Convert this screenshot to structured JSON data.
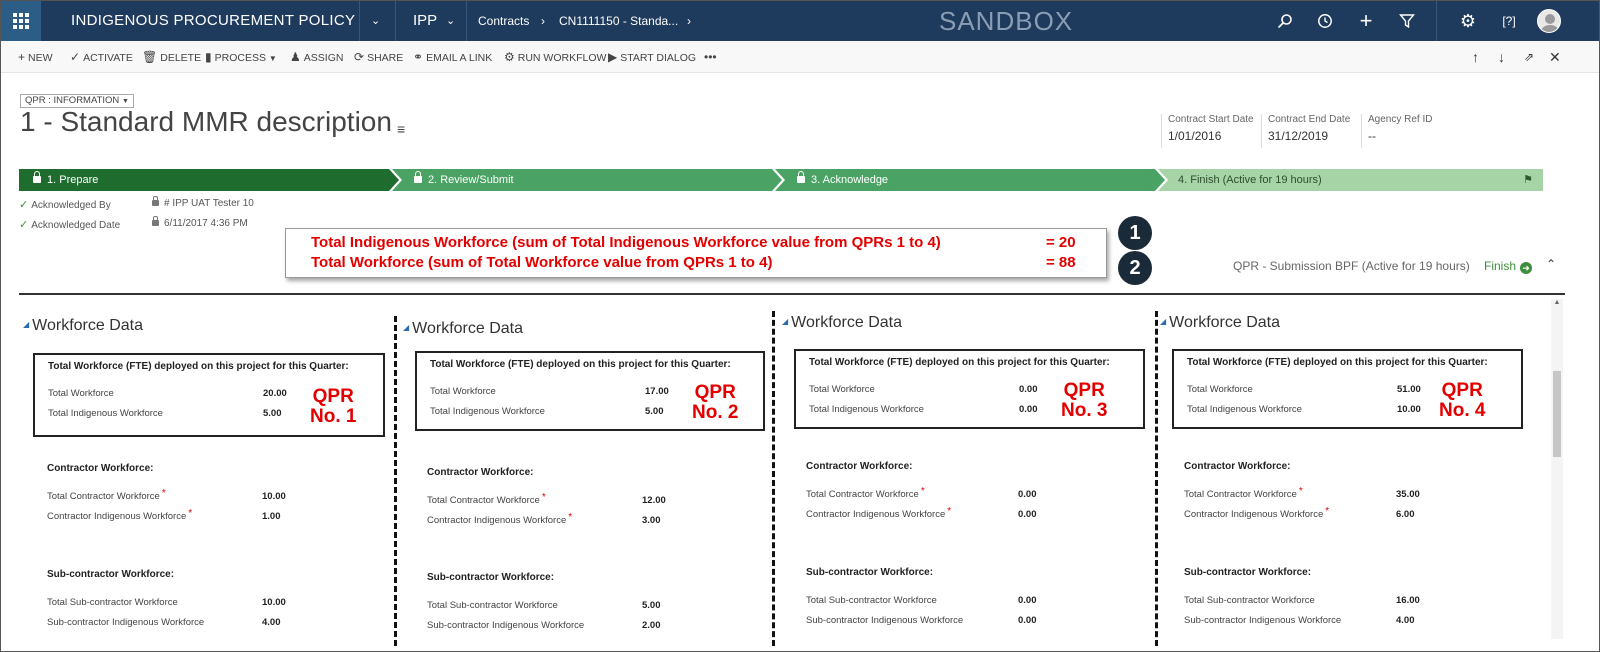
{
  "topnav": {
    "app_title": "INDIGENOUS PROCUREMENT POLICY",
    "area": "IPP",
    "breadcrumb_entity": "Contracts",
    "breadcrumb_record": "CN1111150 - Standa...",
    "environment": "SANDBOX"
  },
  "commands": {
    "new": "NEW",
    "activate": "ACTIVATE",
    "delete": "DELETE",
    "process": "PROCESS",
    "assign": "ASSIGN",
    "share": "SHARE",
    "email_link": "EMAIL A LINK",
    "run_workflow": "RUN WORKFLOW",
    "start_dialog": "START DIALOG",
    "more": "•••"
  },
  "header": {
    "form_selector": "QPR : INFORMATION",
    "record_title": "1 - Standard MMR description",
    "fields": [
      {
        "label": "Contract Start Date",
        "value": "1/01/2016"
      },
      {
        "label": "Contract End Date",
        "value": "31/12/2019"
      },
      {
        "label": "Agency Ref ID",
        "value": "--"
      }
    ]
  },
  "bpf": {
    "stages": [
      {
        "label": "1. Prepare",
        "color": "#1f6d2e"
      },
      {
        "label": "2. Review/Submit",
        "color": "#4aa364"
      },
      {
        "label": "3. Acknowledge",
        "color": "#4aa364"
      },
      {
        "label": "4. Finish (Active for 19 hours)",
        "color": "#a6d4a6"
      }
    ],
    "fields": [
      {
        "label": "Acknowledged By",
        "value": "# IPP UAT Tester 10"
      },
      {
        "label": "Acknowledged Date",
        "value": "6/11/2017  4:36 PM"
      }
    ],
    "status": "QPR - Submission BPF (Active for 19 hours)",
    "finish_label": "Finish"
  },
  "summary": {
    "line1": "Total Indigenous Workforce (sum of Total Indigenous Workforce value from QPRs 1 to 4)",
    "value1": "= 20",
    "line2": "Total Workforce (sum of Total Workforce value from QPRs 1 to 4)",
    "value2": "= 88",
    "badge1": "1",
    "badge2": "2"
  },
  "labels": {
    "section_title": "Workforce Data",
    "box_heading": "Total Workforce (FTE) deployed on this project for this Quarter:",
    "total_workforce": "Total Workforce",
    "total_indigenous": "Total Indigenous Workforce",
    "contractor_heading": "Contractor Workforce:",
    "total_contractor": "Total Contractor Workforce",
    "contractor_indigenous": "Contractor Indigenous Workforce",
    "subcontractor_heading": "Sub-contractor Workforce:",
    "total_subcontractor": "Total Sub-contractor Workforce",
    "subcontractor_indigenous": "Sub-contractor Indigenous Workforce",
    "required_mark": "*"
  },
  "qprs": [
    {
      "tag_line1": "QPR",
      "tag_line2": "No. 1",
      "total_workforce": "20.00",
      "total_indigenous": "5.00",
      "total_contractor": "10.00",
      "contractor_indigenous": "1.00",
      "total_subcontractor": "10.00",
      "subcontractor_indigenous": "4.00"
    },
    {
      "tag_line1": "QPR",
      "tag_line2": "No. 2",
      "total_workforce": "17.00",
      "total_indigenous": "5.00",
      "total_contractor": "12.00",
      "contractor_indigenous": "3.00",
      "total_subcontractor": "5.00",
      "subcontractor_indigenous": "2.00"
    },
    {
      "tag_line1": "QPR",
      "tag_line2": "No. 3",
      "total_workforce": "0.00",
      "total_indigenous": "0.00",
      "total_contractor": "0.00",
      "contractor_indigenous": "0.00",
      "total_subcontractor": "0.00",
      "subcontractor_indigenous": "0.00"
    },
    {
      "tag_line1": "QPR",
      "tag_line2": "No. 4",
      "total_workforce": "51.00",
      "total_indigenous": "10.00",
      "total_contractor": "35.00",
      "contractor_indigenous": "6.00",
      "total_subcontractor": "16.00",
      "subcontractor_indigenous": "4.00"
    }
  ]
}
